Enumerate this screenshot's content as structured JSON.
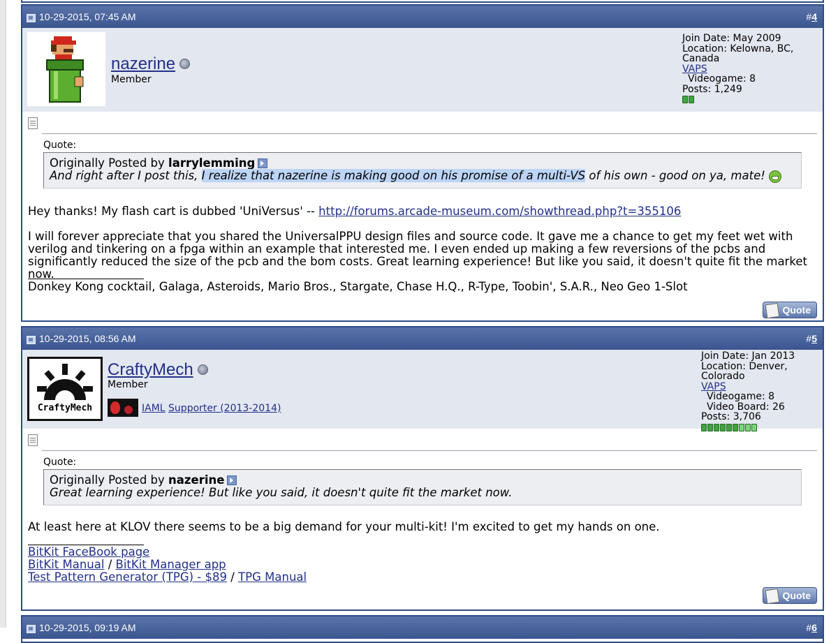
{
  "posts": [
    {
      "date": "10-29-2015, 07:45 AM",
      "number_prefix": "#",
      "number": "4",
      "username": "nazerine",
      "user_title": "Member",
      "join_date": "Join Date: May 2009",
      "location": "Location: Kelowna, BC, Canada",
      "vaps_label": "VAPS",
      "vaps_items": [
        "Videogame: 8"
      ],
      "posts_count": "Posts: 1,249",
      "reputation_pips": 2,
      "quote_label": "Quote:",
      "quote_prefix": "Originally Posted by",
      "quote_author": "larrylemming",
      "quote_text_before": "And right after I post this,",
      "quote_text_highlight": "I realize that nazerine is making good on his promise of a multi-VS",
      "quote_text_after": "of his own - good on ya, mate!",
      "message_line1": "Hey thanks! My flash cart is dubbed 'UniVersus' --",
      "message_link": "http://forums.arcade-museum.com/showthread.php?t=355106",
      "message_para2": "I will forever appreciate that you shared the UniversalPPU design files and source code. It gave me a chance to get my feet wet with verilog and tinkering on a fpga within an example that interested me. I even ended up making a few reversions of the pcbs and significantly reduced the size of the pcb and the bom costs. Great learning experience! But like you said, it doesn't quite fit the market now.",
      "signature": "Donkey Kong cocktail, Galaga, Asteroids, Mario Bros., Stargate, Chase H.Q., R-Type, Toobin', S.A.R., Neo Geo 1-Slot",
      "quote_button": "Quote"
    },
    {
      "date": "10-29-2015, 08:56 AM",
      "number_prefix": "#",
      "number": "5",
      "username": "CraftyMech",
      "user_title": "Member",
      "avatar_text": "CraftyMech",
      "badge_links": [
        "IAML",
        "Supporter (2013-2014)"
      ],
      "join_date": "Join Date: Jan 2013",
      "location": "Location: Denver, Colorado",
      "vaps_label": "VAPS",
      "vaps_items": [
        "Videogame: 8",
        "Video Board: 26"
      ],
      "posts_count": "Posts: 3,706",
      "reputation_pips": 9,
      "quote_label": "Quote:",
      "quote_prefix": "Originally Posted by",
      "quote_author": "nazerine",
      "quote_text": "Great learning experience! But like you said, it doesn't quite fit the market now.",
      "message": "At least here at KLOV there seems to be a big demand for your multi-kit! I'm excited to get my hands on one.",
      "sig_links": {
        "facebook": "BitKit FaceBook page",
        "manual": "BitKit Manual",
        "sep1": " / ",
        "manager": "BitKit Manager app",
        "tpg": "Test Pattern Generator (TPG) - $89",
        "sep2": " / ",
        "tpg_manual": "TPG Manual"
      },
      "quote_button": "Quote"
    },
    {
      "date": "10-29-2015, 09:19 AM",
      "number_prefix": "#",
      "number": "6"
    }
  ],
  "colors": {
    "header_blue": "#3b5590",
    "user_bar": "#e3e7ef",
    "link": "#22308a",
    "highlight": "#bcd4f5"
  }
}
